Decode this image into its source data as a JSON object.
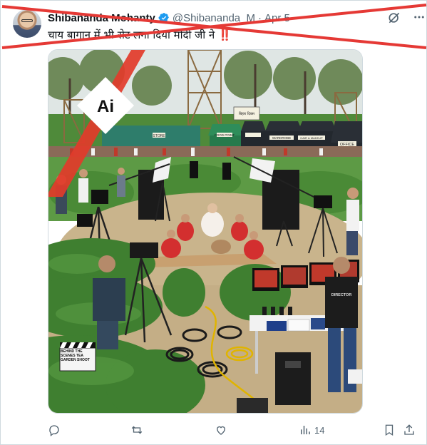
{
  "tweet": {
    "display_name": "Shibananda Mohanty",
    "handle": "@Shibananda_M",
    "separator": "·",
    "date": "Apr 5",
    "text": "चाय बागान में भी सेट लगा दिया मोदी जी ने",
    "text_emphasis": "‼️",
    "verified_color": "#1d9bf0"
  },
  "media": {
    "ai_badge": "Ai",
    "signs": {
      "sign1": "बिहार दिवस",
      "sign2": "STORE",
      "sign3": "FOOD POINT",
      "sign4": "WARDROBE",
      "sign5": "HAIR & MAKEUP",
      "sign6": "OFFICE",
      "clapper": "BEHIND THE SCENES TEA GARDEN SHOOT",
      "vest": "DIRECTOR"
    },
    "strike_color": "#e53935"
  },
  "actions": {
    "reply_count": "",
    "retweet_count": "",
    "like_count": "",
    "views_count": "14"
  }
}
